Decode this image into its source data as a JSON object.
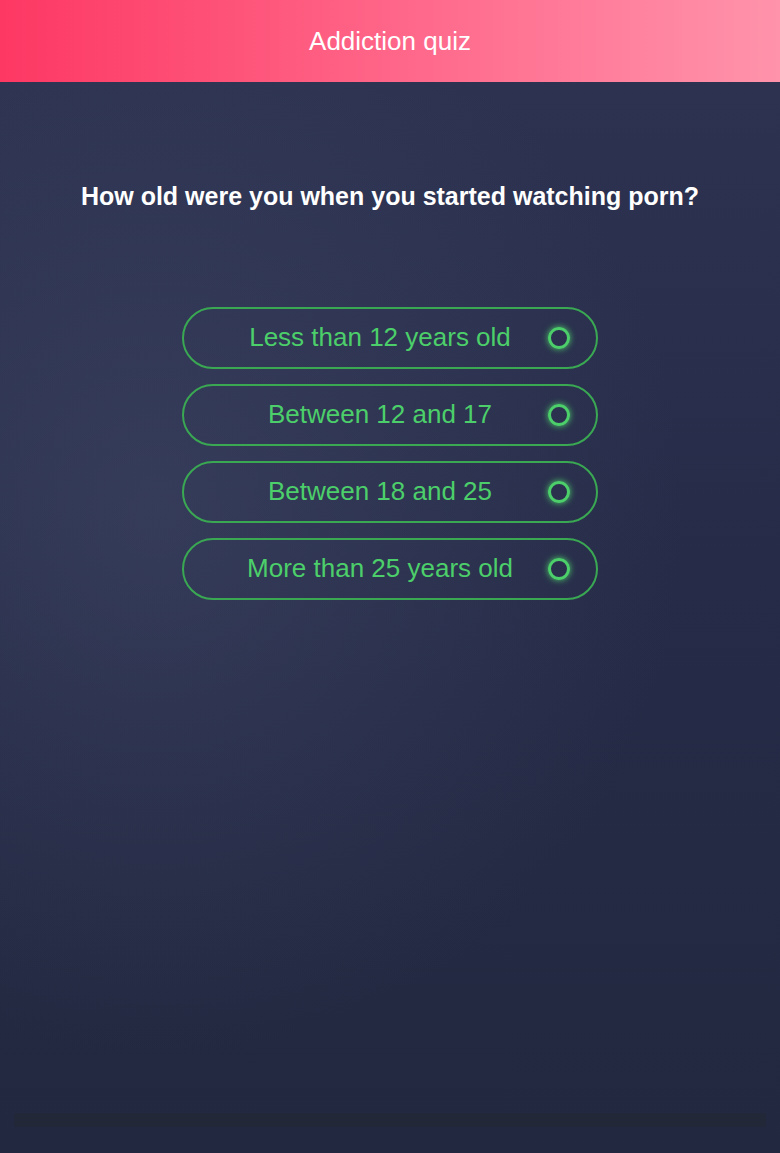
{
  "header": {
    "title": "Addiction quiz"
  },
  "question": "How old were you when you started watching porn?",
  "options": [
    {
      "label": "Less than 12 years old",
      "selected": false
    },
    {
      "label": "Between 12 and 17",
      "selected": false
    },
    {
      "label": "Between 18 and 25",
      "selected": false
    },
    {
      "label": "More than 25 years old",
      "selected": false
    }
  ],
  "progress": {
    "level": 0
  }
}
